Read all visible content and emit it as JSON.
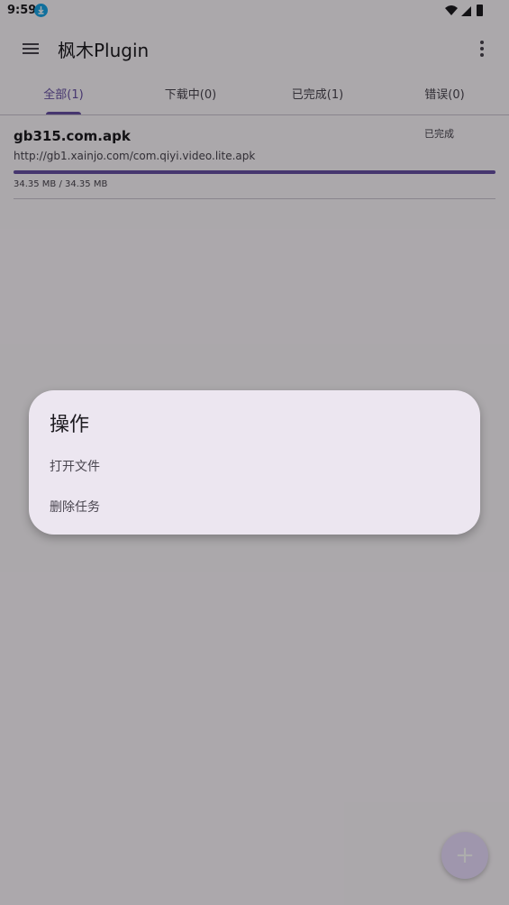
{
  "status_bar": {
    "time": "9:59"
  },
  "app_bar": {
    "title": "枫木Plugin",
    "menu_icon": "hamburger-menu-icon",
    "more_icon": "more-vertical-icon"
  },
  "tabs": [
    {
      "label": "全部(1)",
      "active": true
    },
    {
      "label": "下载中(0)",
      "active": false
    },
    {
      "label": "已完成(1)",
      "active": false
    },
    {
      "label": "错误(0)",
      "active": false
    }
  ],
  "downloads": [
    {
      "file_name": "gb315.com.apk",
      "status": "已完成",
      "url": "http://gb1.xainjo.com/com.qiyi.video.lite.apk",
      "size_text": "34.35 MB / 34.35 MB",
      "progress": 1.0
    }
  ],
  "fab": {
    "icon": "plus-icon",
    "label": "+"
  },
  "dialog": {
    "title": "操作",
    "options": [
      "打开文件",
      "删除任务"
    ]
  },
  "colors": {
    "accent": "#6750a4",
    "dialog_bg": "#ece6f0"
  }
}
